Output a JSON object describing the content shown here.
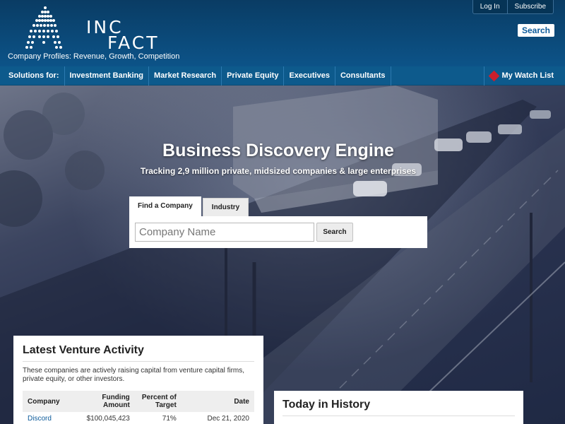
{
  "header": {
    "logo_line1": "Inc",
    "logo_line2": "Fact",
    "tagline": "Company Profiles: Revenue, Growth, Competition",
    "login_label": "Log In",
    "subscribe_label": "Subscribe",
    "search_label": "Search"
  },
  "nav": {
    "items": [
      {
        "label": "Solutions for:"
      },
      {
        "label": "Investment Banking"
      },
      {
        "label": "Market Research"
      },
      {
        "label": "Private Equity"
      },
      {
        "label": "Executives"
      },
      {
        "label": "Consultants"
      }
    ],
    "watch_label": "My Watch List",
    "watch_icon": "diamond-icon",
    "watch_color": "#cc1f2c"
  },
  "hero": {
    "title": "Business Discovery Engine",
    "subtitle": "Tracking 2,9 million private, midsized companies & large enterprises"
  },
  "search_panel": {
    "tabs": [
      {
        "label": "Find a Company",
        "active": true
      },
      {
        "label": "Industry",
        "active": false
      }
    ],
    "input_placeholder": "Company Name",
    "input_value": "",
    "button_label": "Search"
  },
  "venture": {
    "title": "Latest Venture Activity",
    "description": "These companies are actively raising capital from venture capital firms, private equity, or other investors.",
    "columns": [
      "Company",
      "Funding Amount",
      "Percent of Target",
      "Date"
    ],
    "rows": [
      {
        "company": "Discord",
        "amount": "$100,045,423",
        "percent": "71%",
        "date": "Dec 21, 2020"
      }
    ]
  },
  "history": {
    "title": "Today in History"
  },
  "colors": {
    "header_bg": "#0b4a7a",
    "nav_bg": "#0d5a8c",
    "link": "#0b5a9a"
  }
}
